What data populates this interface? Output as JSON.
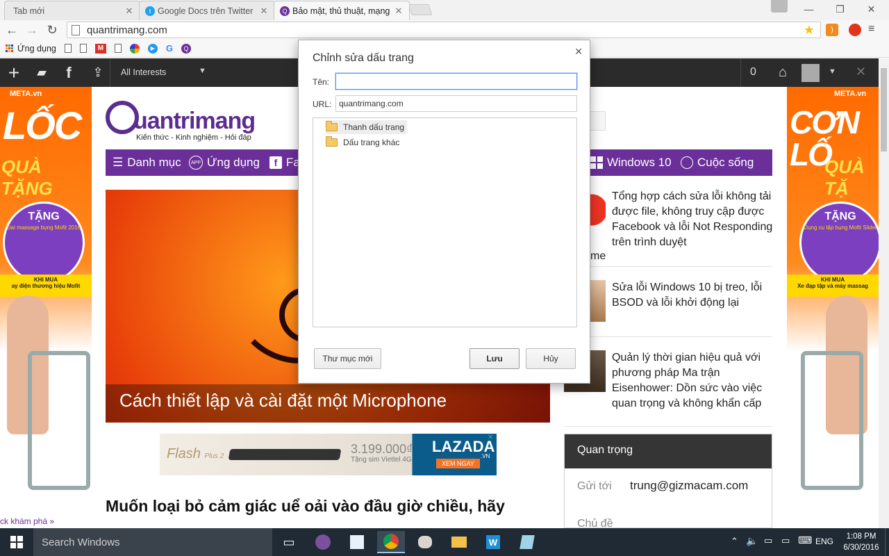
{
  "browser": {
    "tabs": [
      {
        "title": "Tab mới",
        "icon": "blank-page-icon"
      },
      {
        "title": "Google Docs trên Twitter",
        "icon": "twitter-bird-icon"
      },
      {
        "title": "Bảo mật, thủ thuật, mạng",
        "icon": "quantrimang-favicon"
      }
    ],
    "url": "quantrimang.com",
    "bookmarks": [
      {
        "label": "Ứng dụng",
        "icon": "apps-grid-icon"
      }
    ]
  },
  "site": {
    "toolbar_dropdown": "All Interests",
    "counter": "0",
    "logo_word": "uantrimang",
    "logo_tagline": "Kiến thức - Kinh nghiệm - Hỏi đáp",
    "nav": [
      {
        "label": "Danh mục",
        "icon": "menu-icon"
      },
      {
        "label": "Ứng dụng",
        "icon": "app-icon"
      },
      {
        "label": "Fa",
        "icon": "facebook-icon"
      },
      {
        "label": "Windows 10",
        "icon": "windows-icon"
      },
      {
        "label": "Cuộc sống",
        "icon": "life-icon"
      }
    ],
    "hero_caption": "Cách thiết lập và cài đặt một Microphone",
    "headline": "Muốn loại bỏ cảm giác uể oải vào đầu giờ chiều, hãy",
    "headline2": "",
    "news": [
      {
        "title": "Tổng hợp cách sửa lỗi không tải được file, không truy cập được Facebook và lỗi Not Responding trên trình duyệt",
        "tail": "me"
      },
      {
        "title": "Sửa lỗi Windows 10 bị treo, lỗi BSOD và lỗi khởi động lại"
      },
      {
        "title": "Quản lý thời gian hiệu quả với phương pháp Ma trận Eisenhower: Dồn sức vào việc quan trọng và không khẩn cấp"
      }
    ],
    "important": {
      "header": "Quan trọng",
      "to_label": "Gửi tới",
      "to_value": "trung@gizmacam.com",
      "subject_label": "Chủ đề"
    },
    "banner": {
      "brand": "Flash",
      "brand_sup": "Plus 2",
      "price": "3.199.000₫",
      "sim": "Tặng sim Viettel 4G",
      "store": "LAZADA",
      "store_sub": ".VN",
      "cta": "XEM NGAY"
    },
    "ads": {
      "left": {
        "brand": "META.vn",
        "big": "LỐC",
        "sub": "QUÀ TẶNG",
        "gift": "TẶNG",
        "gift_item": "Đai massage bụng Mofit 2016",
        "band_top": "KHI MUA",
        "band": "ay điện thương hiệu Mofit",
        "footer": "ck khám phá »"
      },
      "right": {
        "brand": "META.vn",
        "big": "CƠN LỐ",
        "sub": "QUÀ TẶ",
        "gift": "TẶNG",
        "gift_item": "Dụng cụ tập bụng Mofit Slider",
        "band_top": "KHI MUA",
        "band": "Xe đạp tập và máy massag"
      }
    }
  },
  "dialog": {
    "title": "Chỉnh sửa dấu trang",
    "name_label": "Tên:",
    "name_value": "",
    "url_label": "URL:",
    "url_value": "quantrimang.com",
    "folders": [
      {
        "label": "Thanh dấu trang",
        "selected": true
      },
      {
        "label": "Dấu trang khác",
        "selected": false
      }
    ],
    "new_folder_button": "Thư mục mới",
    "save_button": "Lưu",
    "cancel_button": "Hủy"
  },
  "taskbar": {
    "search_placeholder": "Search Windows",
    "language": "ENG",
    "time": "1:08 PM",
    "date": "6/30/2016"
  },
  "colors": {
    "site_purple": "#6b2f9a",
    "ad_orange": "#ff6a00",
    "focus_blue": "#4d90fe",
    "taskbar": "#1f2a34"
  }
}
